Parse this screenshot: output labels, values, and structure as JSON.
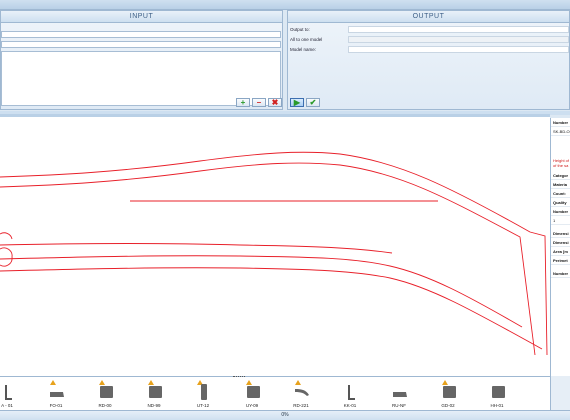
{
  "input": {
    "title": "INPUT",
    "field1": "",
    "field2": "",
    "field3": ""
  },
  "output": {
    "title": "OUTPUT",
    "output_to_label": "Output to:",
    "all_to_one_label": "All to one model",
    "model_name_label": "Model name:",
    "output_to_value": "",
    "model_name_value": ""
  },
  "properties": {
    "rows": [
      {
        "text": "Number",
        "bold": true
      },
      {
        "text": "SK-BD-OF",
        "bold": false
      },
      {
        "text": "Height of",
        "red": true
      },
      {
        "text": "of the sa",
        "red": true
      },
      {
        "text": "Categor",
        "bold": true
      },
      {
        "text": "Materia",
        "bold": true
      },
      {
        "text": "Count:",
        "bold": true
      },
      {
        "text": "Quality",
        "bold": true
      },
      {
        "text": "Number",
        "bold": true
      },
      {
        "text": "1",
        "bold": false
      },
      {
        "text": "Dimensi",
        "bold": true
      },
      {
        "text": "Dimensi",
        "bold": true
      },
      {
        "text": "Area [m",
        "bold": true
      },
      {
        "text": "Perimet",
        "bold": true
      },
      {
        "text": "Number",
        "bold": true
      }
    ]
  },
  "tray": [
    {
      "label": "A - 01",
      "warn": false,
      "shape": "hook"
    },
    {
      "label": "FO-01",
      "warn": true,
      "shape": "flat"
    },
    {
      "label": "RD-00",
      "warn": true,
      "shape": "block"
    },
    {
      "label": "ND-99",
      "warn": true,
      "shape": "block"
    },
    {
      "label": "UT-12",
      "warn": true,
      "shape": "bar"
    },
    {
      "label": "UY-09",
      "warn": true,
      "shape": "block"
    },
    {
      "label": "RD-221",
      "warn": true,
      "shape": "curve"
    },
    {
      "label": "KK-01",
      "warn": false,
      "shape": "hook"
    },
    {
      "label": "RU-NF",
      "warn": false,
      "shape": "flat"
    },
    {
      "label": "GD-02",
      "warn": true,
      "shape": "block"
    },
    {
      "label": "HH-01",
      "warn": false,
      "shape": "block"
    }
  ],
  "status": {
    "progress_text": "0%"
  },
  "colors": {
    "accent": "#3d5f86",
    "outline": "#e8202a",
    "add": "#2a9a2a",
    "remove": "#d02020"
  },
  "icons": {
    "add": "plus-icon",
    "remove": "minus-icon",
    "delete": "x-icon",
    "run": "play-icon",
    "confirm": "check-icon"
  }
}
